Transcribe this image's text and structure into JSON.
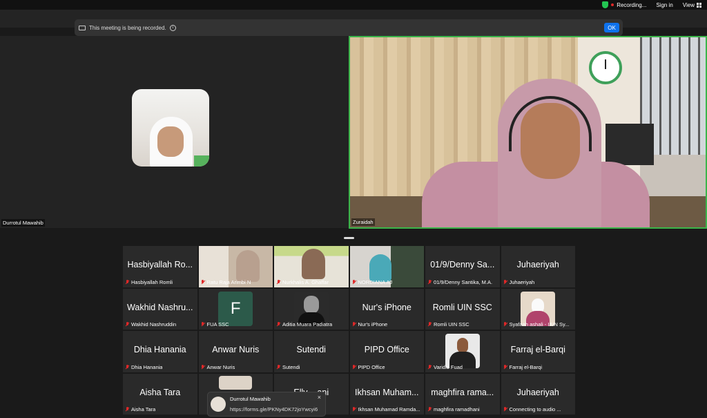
{
  "topbar": {
    "recording_label": "Recording...",
    "sign_in": "Sign in",
    "view": "View"
  },
  "notice": {
    "text": "This meeting is being recorded.",
    "ok": "OK"
  },
  "speakers": {
    "left_name": "Durrotul Mawahib",
    "right_name": "Zuraidah"
  },
  "gallery": [
    {
      "big": "Hasbiyallah Ro...",
      "small": "Hasbiyallah Romli"
    },
    {
      "big": "",
      "small": "Ratu Raja Arimbi N",
      "video": "v1"
    },
    {
      "big": "",
      "small": "Nurkhalis A. Ghaffar",
      "video": "v2"
    },
    {
      "big": "",
      "small": "NORDIANA AJ",
      "video": "v3"
    },
    {
      "big": "01/9/Denny Sa...",
      "small": "01/9/Denny Santika, M.A."
    },
    {
      "big": "Juhaeriyah",
      "small": "Juhaeriyah"
    },
    {
      "big": "Wakhid Nashru...",
      "small": "Wakhid Nashruddin"
    },
    {
      "big": "",
      "small": "FUA SSC",
      "thumb": "f",
      "thumb_text": "F"
    },
    {
      "big": "",
      "small": "Aditia Muara Padiatra",
      "thumb": "dark"
    },
    {
      "big": "Nur's iPhone",
      "small": "Nur's iPhone"
    },
    {
      "big": "Romli UIN SSC",
      "small": "Romli UIN SSC"
    },
    {
      "big": "",
      "small": "Syafaah ashali - IAIN Sy...",
      "thumb": "beige"
    },
    {
      "big": "Dhia Hanania",
      "small": "Dhia Hanania"
    },
    {
      "big": "Anwar Nuris",
      "small": "Anwar Nuris"
    },
    {
      "big": "Sutendi",
      "small": "Sutendi"
    },
    {
      "big": "PIPD Office",
      "small": "PIPD Office"
    },
    {
      "big": "",
      "small": "Varidlo Fuad",
      "thumb": "suit"
    },
    {
      "big": "Farraj el-Barqi",
      "small": "Farraj el-Barqi"
    },
    {
      "big": "Aisha Tara",
      "small": "Aisha Tara"
    },
    {
      "big": "",
      "small": "",
      "thumb": "pair"
    },
    {
      "big": "Elly ...ani",
      "small": ""
    },
    {
      "big": "Ikhsan Muham...",
      "small": "Ikhsan Muhamad Ramda..."
    },
    {
      "big": "maghfira rama...",
      "small": "maghfira ramadhani"
    },
    {
      "big": "Juhaeriyah",
      "small": "Connecting to audio ..."
    }
  ],
  "chat": {
    "sender": "Durrotul Mawahib",
    "message": "https://forms.gle/PKNy4DK72joYwcyi6",
    "close": "×"
  }
}
